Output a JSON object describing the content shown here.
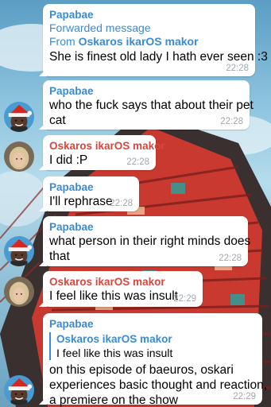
{
  "messages": [
    {
      "sender": "Papabae",
      "forwarded_label": "Forwarded message",
      "forwarded_from_prefix": "From ",
      "forwarded_from": "Oskaros ikarOS makor",
      "text": "She is finest old lady I hath ever seen :3",
      "time": "22:28"
    },
    {
      "sender": "Papabae",
      "text_line1": "who the fuck says that about their pet",
      "text_line2": "cat",
      "time": "22:28"
    },
    {
      "sender": "Oskaros ikarOS makor",
      "text": "I did :P",
      "time": "22:28"
    },
    {
      "sender": "Papabae",
      "text": "I'll rephrase",
      "time": "22:28"
    },
    {
      "sender": "Papabae",
      "text_line1": "what person in their right minds does",
      "text_line2": "that",
      "time": "22:28"
    },
    {
      "sender": "Oskaros ikarOS makor",
      "text": "I feel like this was insult",
      "time": "22:29"
    },
    {
      "sender": "Papabae",
      "reply_to_name": "Oskaros ikarOS makor",
      "reply_to_text": "I feel like this was insult",
      "text_line1": "on this episode of baeuros, oskari",
      "text_line2": "experiences basic thought and reaction,",
      "text_line3": "a premiere on the show",
      "time": "22:29"
    }
  ],
  "avatars": {
    "papabae": "avatar-santa-hat",
    "oskaros": "avatar-blonde"
  },
  "colors": {
    "papabae_name": "#3a8bd4",
    "oskaros_name": "#d9463e",
    "bubble": "#ffffff",
    "time": "#a3a8ad"
  }
}
